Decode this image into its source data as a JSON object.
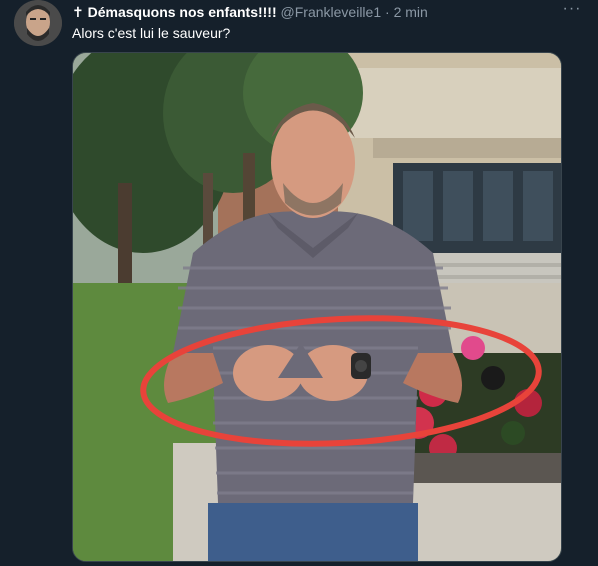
{
  "tweet": {
    "display_name": "✝ Démasquons nos enfants!!!!",
    "handle": "@Frankleveille1",
    "separator": "·",
    "time": "2 min",
    "more_label": "···",
    "text": "Alors c'est lui le sauveur?"
  },
  "icons": {
    "avatar": "user-avatar-photo",
    "more": "more-options-icon"
  },
  "colors": {
    "background": "#15202b",
    "secondary_text": "#8b98a5",
    "annotation_circle": "#e8433a"
  }
}
